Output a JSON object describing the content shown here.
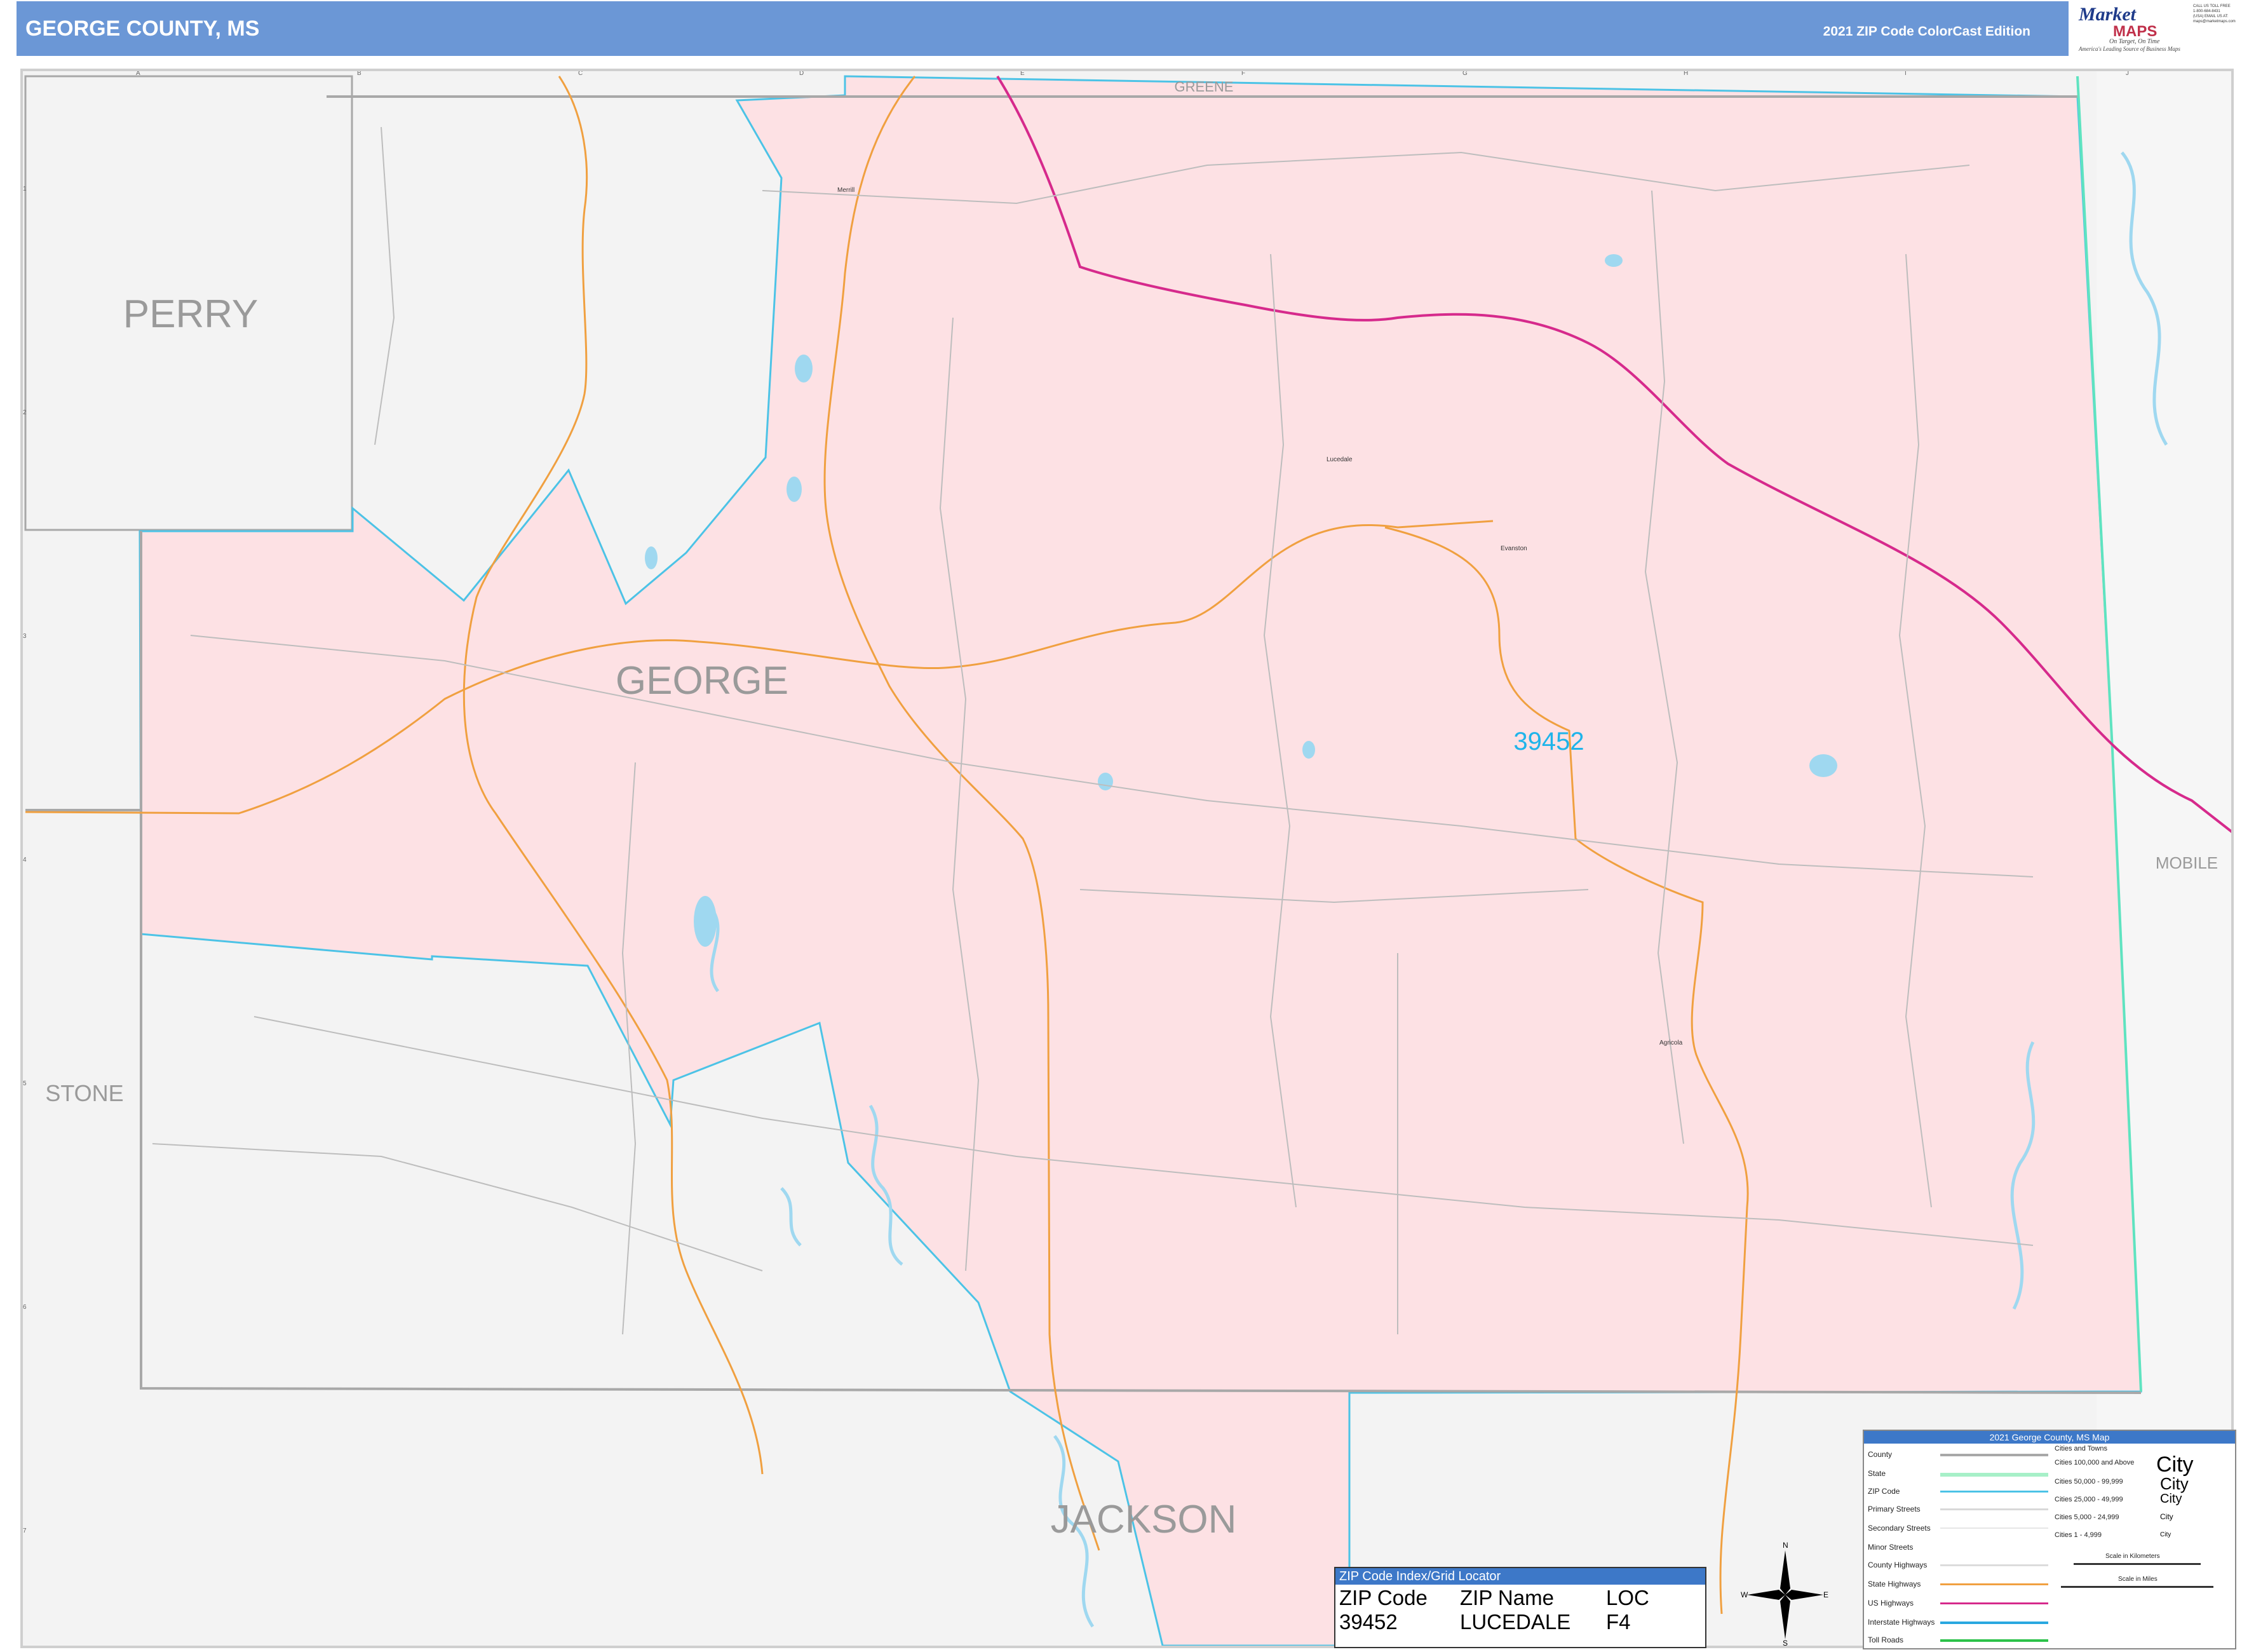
{
  "header": {
    "title": "GEORGE COUNTY, MS",
    "edition": "2021 ZIP Code ColorCast Edition"
  },
  "logo": {
    "mark": "Market",
    "maps": "MAPS",
    "tagline1": "On Target, On Time",
    "tagline2": "America's Leading Source of Business Maps",
    "contact": "CALL US TOLL FREE 1-800-684-8431 (USA) EMAIL US AT: maps@marketmaps.com"
  },
  "colors": {
    "zip_fill": "#fde1e4",
    "outside_fill": "#f3f3f3",
    "zip_boundary": "#4cc3e6",
    "state_boundary": "#5fe3c0",
    "county_boundary": "#a8a8a8",
    "interstate": "#d62a8c",
    "highway": "#f0a040",
    "water": "#9fd8f0"
  },
  "map": {
    "counties": [
      {
        "name": "PERRY"
      },
      {
        "name": "GEORGE"
      },
      {
        "name": "STONE"
      },
      {
        "name": "JACKSON"
      },
      {
        "name": "GREENE"
      },
      {
        "name": "MOBILE"
      }
    ],
    "zip_label": "39452",
    "towns": [
      "Merrill",
      "Lucedale",
      "Evanston",
      "Agricola"
    ],
    "grid_cols": [
      "A",
      "B",
      "C",
      "D",
      "E",
      "F",
      "G",
      "H",
      "I",
      "J"
    ],
    "grid_rows": [
      "1",
      "2",
      "3",
      "4",
      "5",
      "6",
      "7"
    ]
  },
  "zip_index": {
    "heading": "ZIP Code Index/Grid Locator",
    "col_zip": "ZIP Code",
    "col_name": "ZIP Name",
    "col_loc": "LOC",
    "rows": [
      {
        "zip": "39452",
        "name": "LUCEDALE",
        "loc": "F4"
      }
    ]
  },
  "compass": {
    "n": "N",
    "s": "S",
    "e": "E",
    "w": "W"
  },
  "legend": {
    "title": "2021 George County, MS Map",
    "items": [
      "County",
      "State",
      "ZIP Code",
      "Primary Streets",
      "Secondary Streets",
      "Minor Streets",
      "County Highways",
      "State Highways",
      "US Highways",
      "Interstate Highways",
      "Toll Roads"
    ],
    "cities_heading": "Cities and Towns",
    "city_classes": [
      "Cities 100,000 and Above",
      "Cities 50,000 - 99,999",
      "Cities 25,000 - 49,999",
      "Cities 5,000 - 24,999",
      "Cities 1 - 4,999"
    ],
    "city_word": "City",
    "scale_km": "Scale in Kilometers",
    "scale_mi": "Scale in Miles"
  }
}
